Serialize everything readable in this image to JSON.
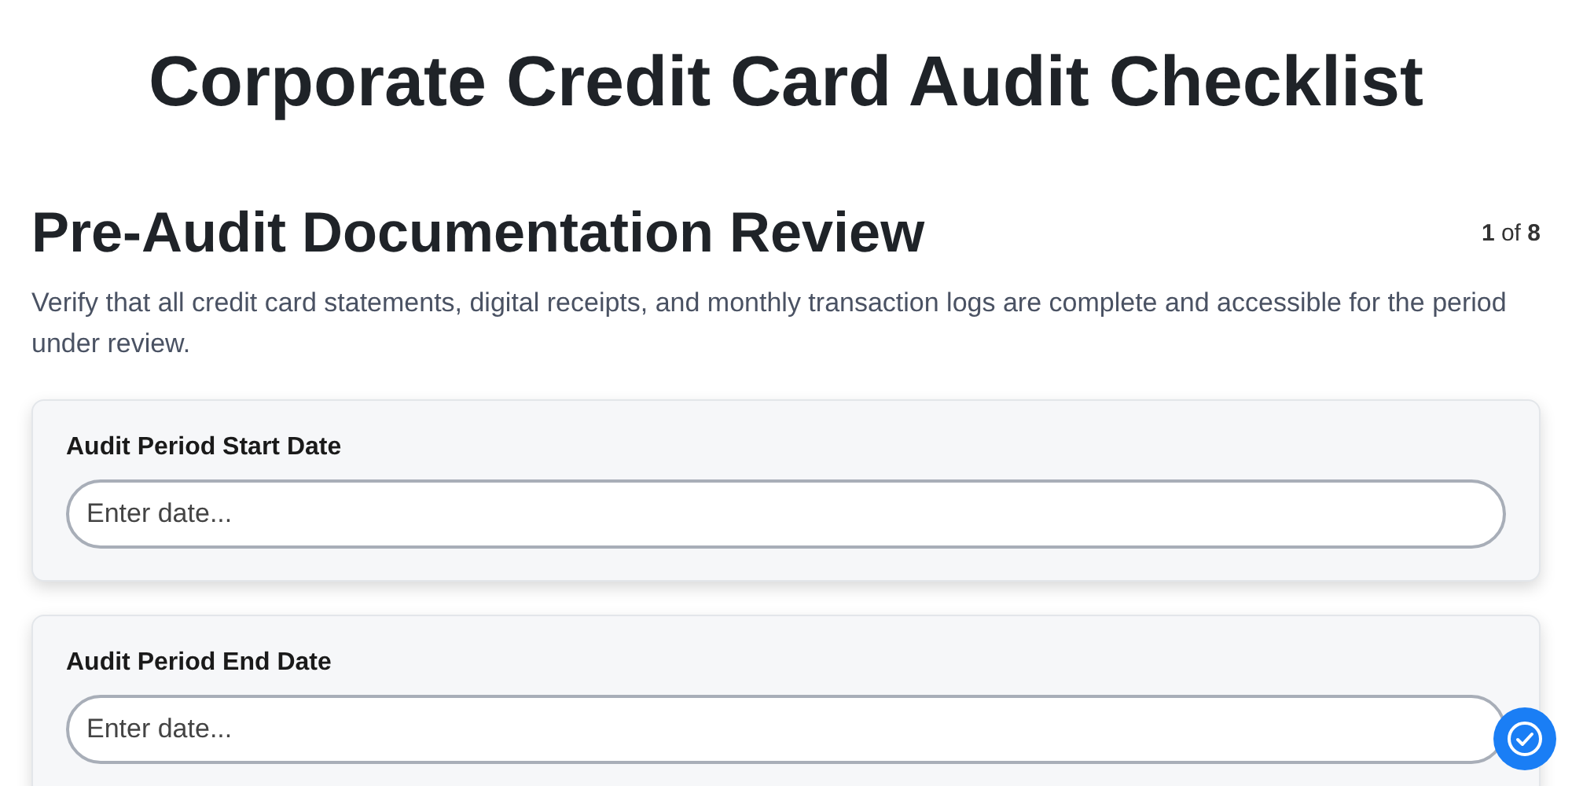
{
  "title": "Corporate Credit Card Audit Checklist",
  "section": {
    "heading": "Pre-Audit Documentation Review",
    "counter": "**1** of **8**",
    "description": "Verify that all credit card statements, digital receipts, and monthly transaction logs are complete and accessible for the period under review."
  },
  "fields": [
    {
      "label": "Audit Period Start Date",
      "placeholder": "Enter date..."
    },
    {
      "label": "Audit Period End Date",
      "placeholder": "Enter date..."
    }
  ]
}
